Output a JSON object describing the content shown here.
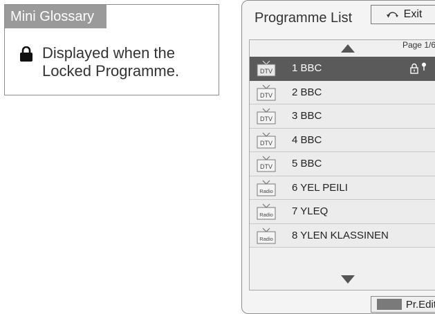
{
  "glossary": {
    "title": "Mini Glossary",
    "lock_icon": "lock-icon",
    "description_line1": "Displayed when the",
    "description_line2": "Locked Programme."
  },
  "programme_list": {
    "title": "Programme List",
    "exit_label": "Exit",
    "exit_icon": "back-arrow-icon",
    "page_indicator": "Page 1/6",
    "rows": [
      {
        "type": "DTV",
        "name": "1 BBC",
        "selected": true,
        "locked": true
      },
      {
        "type": "DTV",
        "name": "2 BBC",
        "selected": false,
        "locked": false
      },
      {
        "type": "DTV",
        "name": "3 BBC",
        "selected": false,
        "locked": false
      },
      {
        "type": "DTV",
        "name": "4 BBC",
        "selected": false,
        "locked": false
      },
      {
        "type": "DTV",
        "name": "5 BBC",
        "selected": false,
        "locked": false
      },
      {
        "type": "Radio",
        "name": "6 YEL PEILI",
        "selected": false,
        "locked": false
      },
      {
        "type": "Radio",
        "name": "7 YLEQ",
        "selected": false,
        "locked": false
      },
      {
        "type": "Radio",
        "name": "8 YLEN KLASSINEN",
        "selected": false,
        "locked": false
      }
    ],
    "pr_edit_label": "Pr.Edit",
    "pr_edit_color": "#7a7a7a"
  },
  "colors": {
    "selected_row": "#5a5a5a",
    "glossary_tab": "#9a9a9a"
  }
}
